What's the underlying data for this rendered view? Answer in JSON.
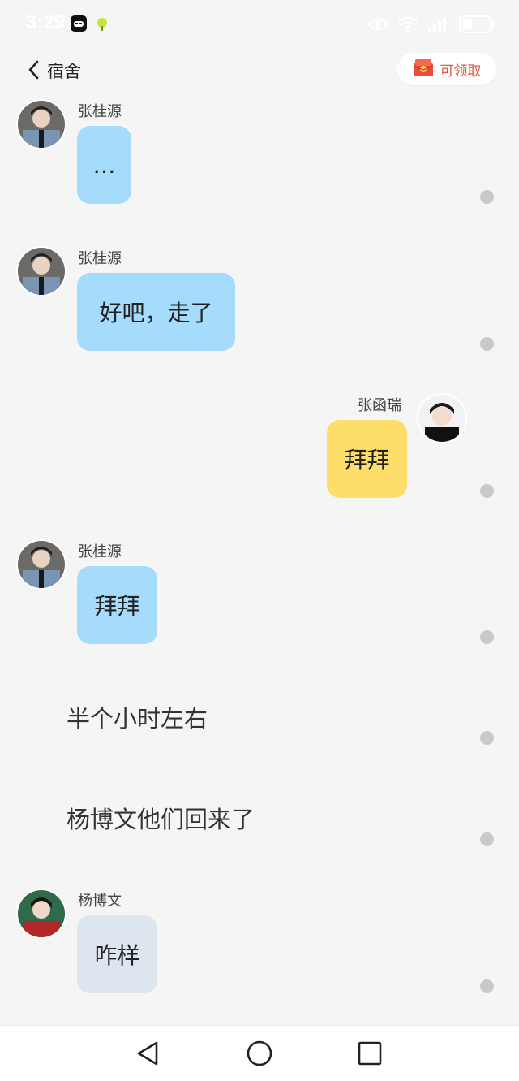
{
  "status_bar": {
    "time": "3:29",
    "icons": [
      "app-icon",
      "lime-app-icon",
      "eye-icon",
      "wifi-icon",
      "signal-icon",
      "battery-icon"
    ]
  },
  "header": {
    "title": "宿舍",
    "claim_label": "可领取"
  },
  "messages": [
    {
      "type": "bubble",
      "sender": "张桂源",
      "text": "…",
      "side": "left",
      "color": "#a6dcfb"
    },
    {
      "type": "bubble",
      "sender": "张桂源",
      "text": "好吧，走了",
      "side": "left",
      "color": "#a6dcfb"
    },
    {
      "type": "bubble",
      "sender": "张函瑞",
      "text": "拜拜",
      "side": "right",
      "color": "#fede6a"
    },
    {
      "type": "bubble",
      "sender": "张桂源",
      "text": "拜拜",
      "side": "left",
      "color": "#a6dcfb"
    },
    {
      "type": "narration",
      "text": "半个小时左右"
    },
    {
      "type": "narration",
      "text": "杨博文他们回来了"
    },
    {
      "type": "bubble",
      "sender": "杨博文",
      "text": "咋样",
      "side": "left",
      "color": "#dde5ee"
    }
  ],
  "navbar": {
    "icons": [
      "back-triangle-icon",
      "home-circle-icon",
      "recents-square-icon"
    ]
  }
}
